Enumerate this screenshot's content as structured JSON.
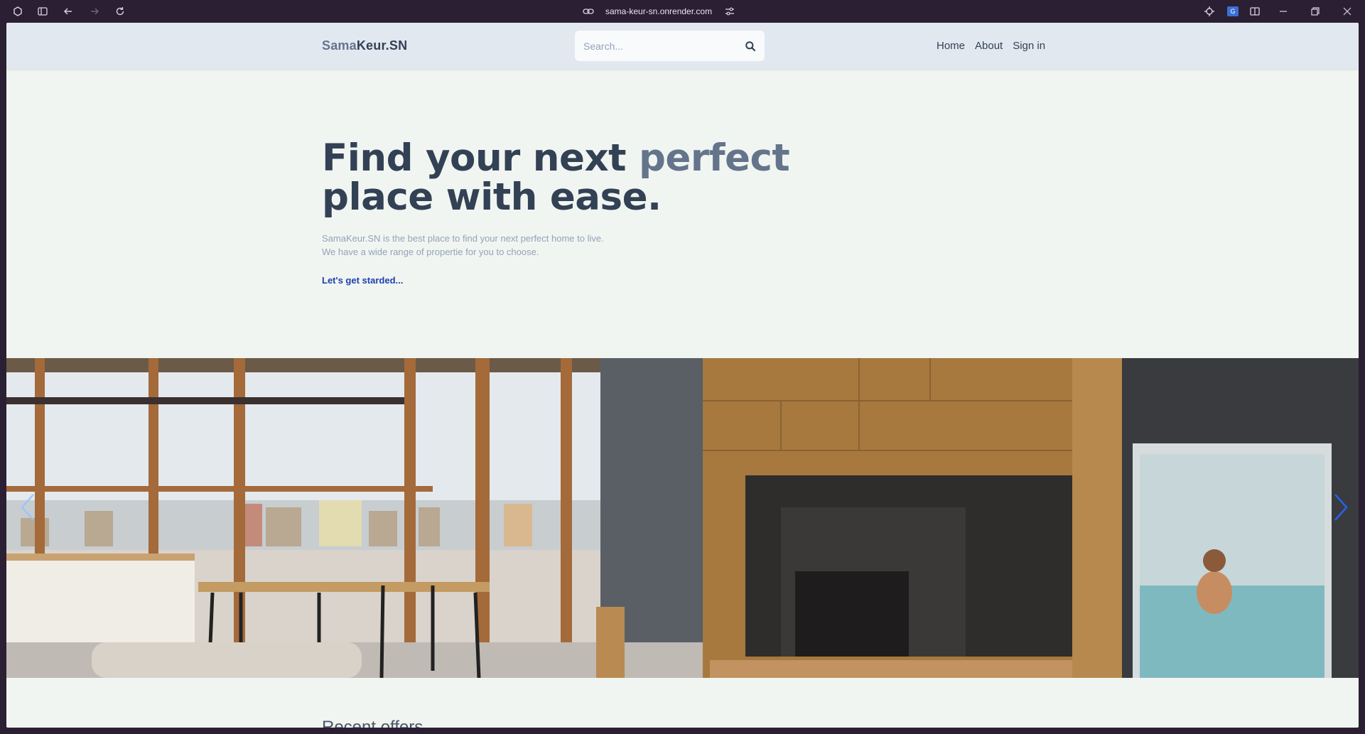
{
  "browser": {
    "url": "sama-keur-sn.onrender.com",
    "translate_badge": "G"
  },
  "header": {
    "logo_part1": "Sama",
    "logo_part2": "Keur.SN",
    "search_placeholder": "Search...",
    "nav": [
      "Home",
      "About",
      "Sign in"
    ]
  },
  "hero": {
    "title_line1_start": "Find your next ",
    "title_line1_accent": "perfect",
    "title_line2": "place with ease.",
    "subtitle_line1": "SamaKeur.SN is the best place to find your next perfect home to live.",
    "subtitle_line2": "We have a wide range of propertie for you to choose.",
    "cta": "Let's get starded..."
  },
  "section": {
    "title": "Recent offers"
  },
  "colors": {
    "header_bg": "#e2e8f0",
    "page_bg": "#f1f5f1",
    "title": "#334155",
    "accent": "#64748b",
    "cta": "#1e40af",
    "arrow": "#2563eb"
  }
}
